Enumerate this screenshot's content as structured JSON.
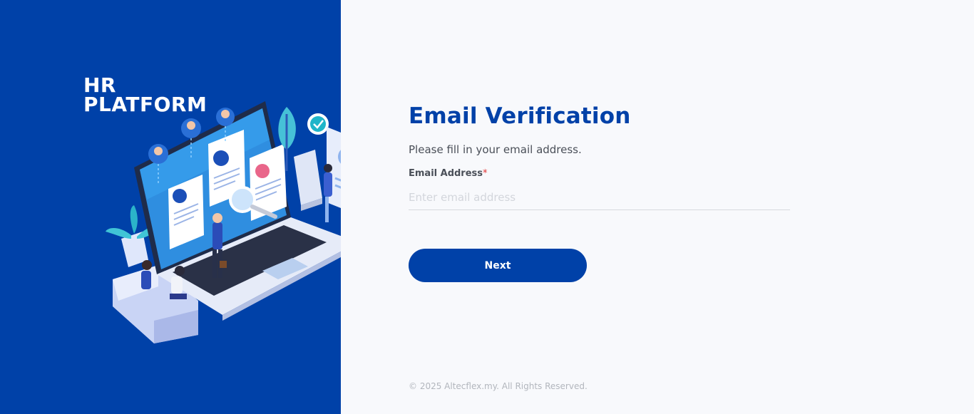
{
  "brand": {
    "line1": "HR",
    "line2": "PLATFORM"
  },
  "illustration": {
    "icon": "hr-laptop-illustration"
  },
  "form": {
    "title": "Email Verification",
    "subtitle": "Please fill in your email address.",
    "email_label": "Email Address",
    "required_mark": "*",
    "email_placeholder": "Enter email address",
    "email_value": "",
    "next_label": "Next"
  },
  "footer": {
    "copyright": "© 2025 Altecflex.my. All Rights Reserved."
  },
  "colors": {
    "brand_blue": "#0041a8",
    "background": "#f8f9fc",
    "required": "#e03131"
  }
}
